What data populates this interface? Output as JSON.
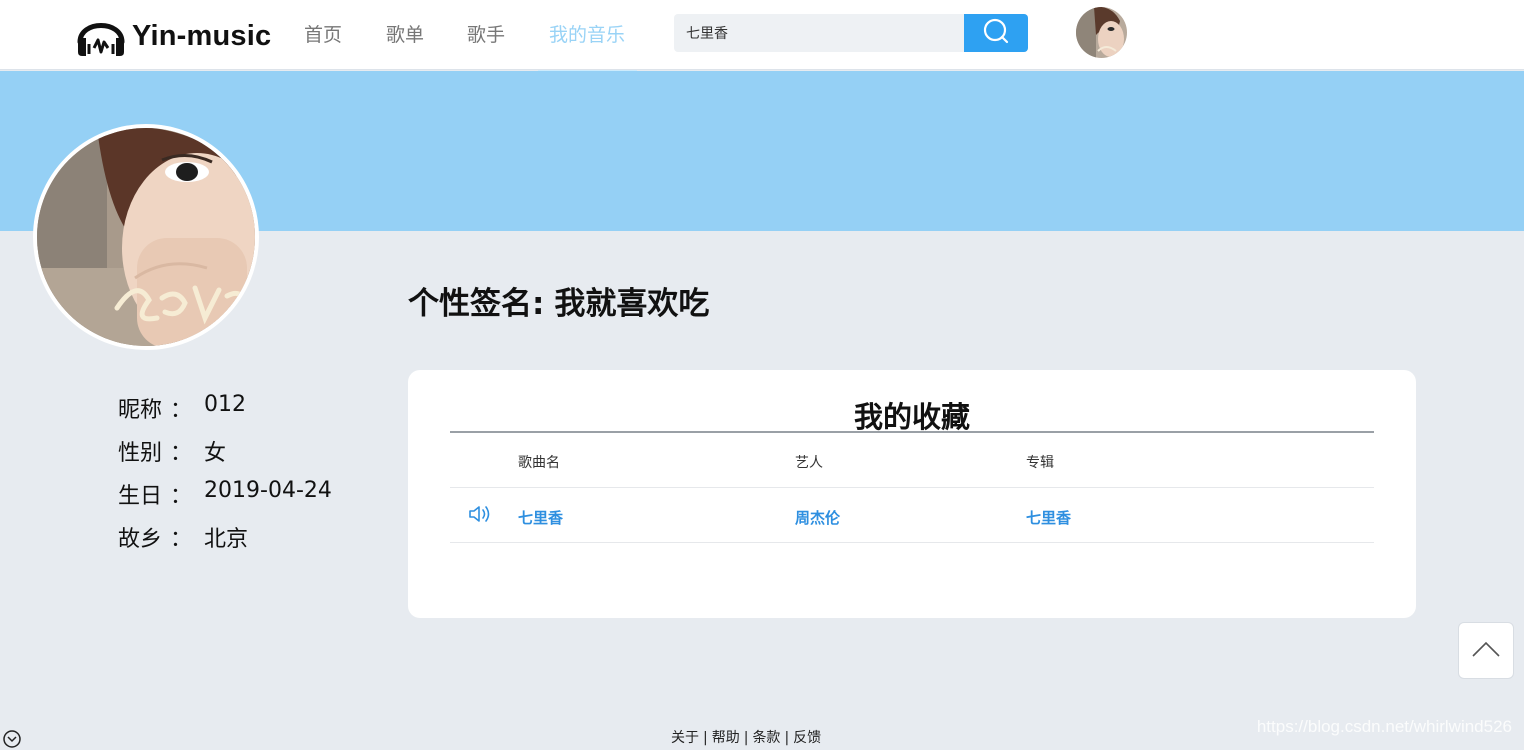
{
  "header": {
    "brand": "Yin-music",
    "nav": [
      {
        "label": "首页",
        "active": false
      },
      {
        "label": "歌单",
        "active": false
      },
      {
        "label": "歌手",
        "active": false
      },
      {
        "label": "我的音乐",
        "active": true
      }
    ],
    "search": {
      "value": "七里香",
      "icon": "search-icon"
    },
    "user_avatar": "user-avatar"
  },
  "profile": {
    "info": [
      {
        "label": "昵称",
        "sep": "：",
        "value": "012"
      },
      {
        "label": "性别",
        "sep": "：",
        "value": "女"
      },
      {
        "label": "生日",
        "sep": "：",
        "value": "2019-04-24"
      },
      {
        "label": "故乡",
        "sep": "：",
        "value": "北京"
      }
    ],
    "signature": {
      "label": "个性签名:",
      "value": "我就喜欢吃"
    }
  },
  "collection": {
    "title": "我的收藏",
    "columns": [
      "歌曲名",
      "艺人",
      "专辑"
    ],
    "rows": [
      {
        "song": "七里香",
        "artist": "周杰伦",
        "album": "七里香",
        "icon": "speaker-icon"
      }
    ]
  },
  "footer": {
    "links": [
      "关于",
      "帮助",
      "条款",
      "反馈"
    ],
    "separator": "|",
    "watermark": "https://blog.csdn.net/whirlwind526"
  },
  "colors": {
    "accent": "#2ea1f2",
    "banner": "#95d0f5",
    "nav_active": "#99d3f6",
    "link": "#2e8fe0",
    "page_bg": "#e7ebf0"
  }
}
